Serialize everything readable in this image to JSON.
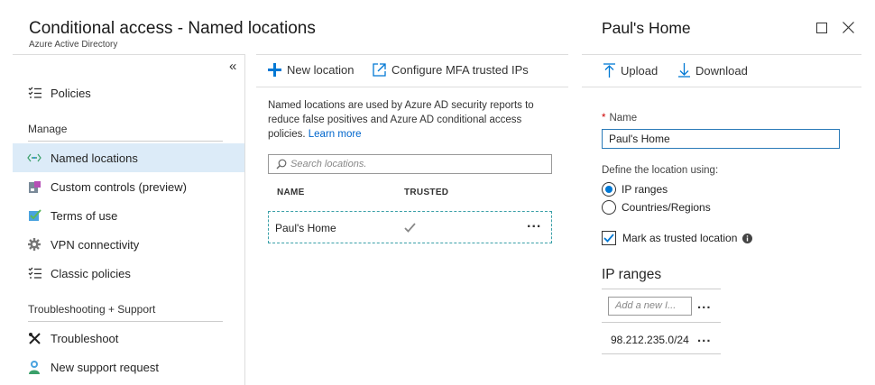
{
  "header": {
    "title": "Conditional access - Named locations",
    "subtitle": "Azure Active Directory"
  },
  "sidebar": {
    "collapse_glyph": "«",
    "items": [
      {
        "label": "Policies",
        "icon": "list-icon"
      },
      {
        "label": "Named locations",
        "icon": "named-locations-icon",
        "active": true
      },
      {
        "label": "Custom controls (preview)",
        "icon": "custom-controls-icon"
      },
      {
        "label": "Terms of use",
        "icon": "terms-of-use-icon"
      },
      {
        "label": "VPN connectivity",
        "icon": "gear-icon"
      },
      {
        "label": "Classic policies",
        "icon": "list-icon"
      },
      {
        "label": "Troubleshoot",
        "icon": "tools-icon"
      },
      {
        "label": "New support request",
        "icon": "support-person-icon"
      }
    ],
    "sections": {
      "manage": "Manage",
      "troubleshooting": "Troubleshooting + Support"
    }
  },
  "toolbar": {
    "new_location": "New location",
    "configure_mfa": "Configure MFA trusted IPs"
  },
  "main": {
    "description": "Named locations are used by Azure AD security reports to reduce false positives and Azure AD conditional access policies.",
    "learn_more": "Learn more",
    "search_placeholder": "Search locations.",
    "columns": {
      "name": "NAME",
      "trusted": "TRUSTED"
    },
    "rows": [
      {
        "name": "Paul's Home",
        "trusted": true,
        "more": "..."
      }
    ]
  },
  "detail": {
    "title": "Paul's Home",
    "upload": "Upload",
    "download": "Download",
    "name_label": "Name",
    "required_mark": "*",
    "name_value": "Paul's Home",
    "define_label": "Define the location using:",
    "options": {
      "ip_ranges": "IP ranges",
      "countries": "Countries/Regions"
    },
    "selected_option": "IP ranges",
    "mark_trusted": "Mark as trusted location",
    "mark_trusted_checked": true,
    "ip_ranges_title": "IP ranges",
    "ip_placeholder": "Add a new I...",
    "ip_list": [
      "98.212.235.0/24"
    ],
    "more": "..."
  },
  "colors": {
    "accent": "#0078d4",
    "active_bg": "#dcebf8",
    "link": "#0066cc",
    "row_border": "#3aa0a8"
  }
}
